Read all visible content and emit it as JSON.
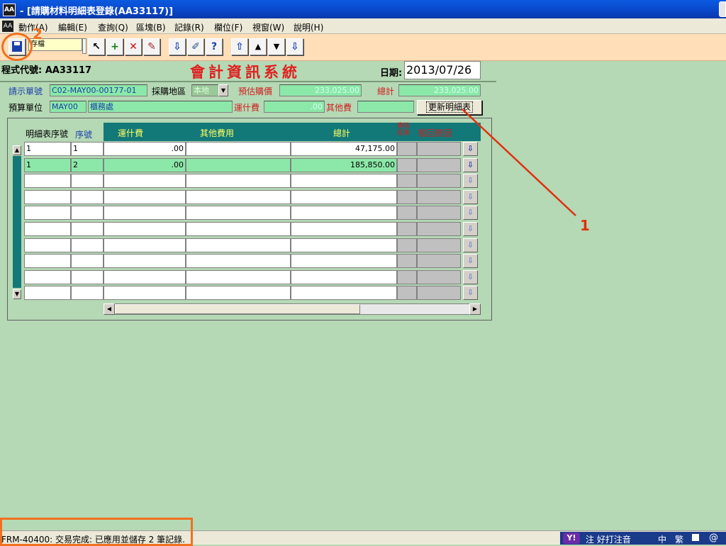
{
  "window": {
    "icon_text": "AA",
    "title": " - [請購材料明細表登錄(AA33117)]"
  },
  "menu": {
    "icon_text": "AA",
    "items": [
      "動作(A)",
      "編輯(E)",
      "查詢(Q)",
      "區塊(B)",
      "記錄(R)",
      "欄位(F)",
      "視窗(W)",
      "說明(H)"
    ]
  },
  "toolbar": {
    "save_tooltip": "存檔",
    "buttons": [
      {
        "name": "query-icon",
        "glyph": "↖"
      },
      {
        "name": "insert-record-icon",
        "glyph": "+"
      },
      {
        "name": "delete-record-icon",
        "glyph": "✕"
      },
      {
        "name": "clear-icon",
        "glyph": "✎"
      },
      {
        "name": "list-values-icon",
        "glyph": "⇩"
      },
      {
        "name": "edit-icon",
        "glyph": "✐"
      },
      {
        "name": "help-icon",
        "glyph": "?"
      },
      {
        "name": "first-record-icon",
        "glyph": "⇧"
      },
      {
        "name": "previous-record-icon",
        "glyph": "▲"
      },
      {
        "name": "next-record-icon",
        "glyph": "▼"
      },
      {
        "name": "last-record-icon",
        "glyph": "⇩"
      }
    ]
  },
  "annotations": {
    "label_1": "1",
    "label_2": "2"
  },
  "header": {
    "program_label": "程式代號: AA33117",
    "system_title": "會計資訊系統",
    "date_label": "日期:",
    "date_value": "2013/07/26"
  },
  "form": {
    "req_no_label": "請示單號",
    "req_no_value": "C02-MAY00-00177-01",
    "purchase_area_label": "採購地區",
    "purchase_area_value": "本地",
    "est_price_label": "預估購價",
    "est_price_value": "233,025.00",
    "total_label": "總計",
    "total_value": "233,025.00",
    "budget_unit_label": "預算單位",
    "budget_unit_code": "MAY00",
    "budget_unit_name": "櫃務處",
    "shipping_label": "運什費",
    "shipping_value": ".00",
    "other_fee_label": "其他費",
    "other_fee_value": "",
    "update_button": "更新明細表"
  },
  "grid": {
    "left_headers": {
      "detail_no": "明細表序號",
      "seq": "序號"
    },
    "headers": {
      "shipping": "運什費",
      "other_fees": "其他費用",
      "total": "總計",
      "check_result": "審核結果",
      "reject_reason": "駁回原因"
    },
    "rows": [
      {
        "detail_no": "1",
        "seq": "1",
        "shipping": ".00",
        "other": "",
        "total": "47,175.00",
        "selected": false
      },
      {
        "detail_no": "1",
        "seq": "2",
        "shipping": ".00",
        "other": "",
        "total": "185,850.00",
        "selected": true
      },
      {
        "detail_no": "",
        "seq": "",
        "shipping": "",
        "other": "",
        "total": "",
        "selected": false
      },
      {
        "detail_no": "",
        "seq": "",
        "shipping": "",
        "other": "",
        "total": "",
        "selected": false
      },
      {
        "detail_no": "",
        "seq": "",
        "shipping": "",
        "other": "",
        "total": "",
        "selected": false
      },
      {
        "detail_no": "",
        "seq": "",
        "shipping": "",
        "other": "",
        "total": "",
        "selected": false
      },
      {
        "detail_no": "",
        "seq": "",
        "shipping": "",
        "other": "",
        "total": "",
        "selected": false
      },
      {
        "detail_no": "",
        "seq": "",
        "shipping": "",
        "other": "",
        "total": "",
        "selected": false
      },
      {
        "detail_no": "",
        "seq": "",
        "shipping": "",
        "other": "",
        "total": "",
        "selected": false
      },
      {
        "detail_no": "",
        "seq": "",
        "shipping": "",
        "other": "",
        "total": "",
        "selected": false
      }
    ],
    "row_button_glyph": "⇩"
  },
  "status": {
    "message": "FRM-40400: 交易完成: 已應用並儲存 2 筆記錄."
  },
  "ime": {
    "logo": "Y!",
    "text": "注 好打注音",
    "lang": "中",
    "mode": "繁"
  },
  "colors": {
    "accent_orange": "#f07020",
    "annotation_red": "#e03010",
    "header_teal": "#137878",
    "field_green": "#8ce8a8"
  }
}
